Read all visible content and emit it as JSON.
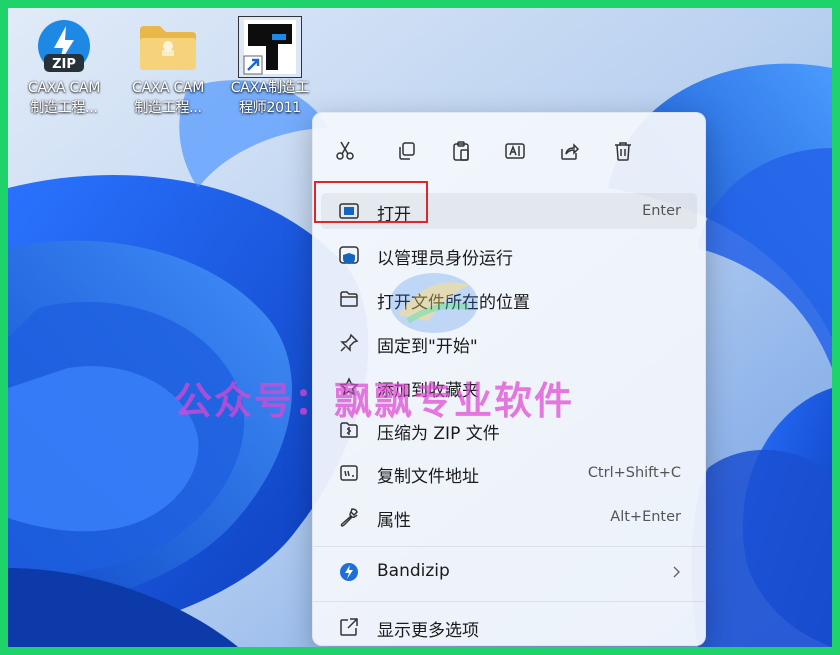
{
  "desktop": {
    "icons": [
      {
        "line1": "CAXA CAM",
        "line2": "制造工程...",
        "badge": "ZIP",
        "icon": "zip-archive-icon"
      },
      {
        "line1": "CAXA CAM",
        "line2": "制造工程...",
        "icon": "folder-icon"
      },
      {
        "line1": "CAXA制造工",
        "line2": "程师2011",
        "icon": "caxa-app-shortcut-icon"
      }
    ]
  },
  "context_menu": {
    "toolbar": [
      {
        "icon": "cut-icon"
      },
      {
        "icon": "copy-icon"
      },
      {
        "icon": "paste-icon"
      },
      {
        "icon": "rename-icon"
      },
      {
        "icon": "share-icon"
      },
      {
        "icon": "delete-icon"
      }
    ],
    "items": [
      {
        "label": "打开",
        "shortcut": "Enter",
        "icon": "open-app-icon"
      },
      {
        "label": "以管理员身份运行",
        "shortcut": "",
        "icon": "shield-run-icon"
      },
      {
        "label": "打开文件所在的位置",
        "shortcut": "",
        "icon": "folder-open-icon"
      },
      {
        "label": "固定到\"开始\"",
        "shortcut": "",
        "icon": "pin-icon"
      },
      {
        "label": "添加到收藏夹",
        "shortcut": "",
        "icon": "star-icon"
      },
      {
        "label": "压缩为 ZIP 文件",
        "shortcut": "",
        "icon": "zip-compress-icon"
      },
      {
        "label": "复制文件地址",
        "shortcut": "Ctrl+Shift+C",
        "icon": "copy-path-icon"
      },
      {
        "label": "属性",
        "shortcut": "Alt+Enter",
        "icon": "wrench-icon"
      },
      {
        "label": "Bandizip",
        "shortcut": "",
        "icon": "bandizip-icon"
      },
      {
        "label": "显示更多选项",
        "shortcut": "",
        "icon": "more-options-icon"
      }
    ]
  },
  "watermark": {
    "text": "公众号：飘飘专业软件"
  },
  "colors": {
    "frame": "#1fd36b",
    "highlight": "#e0262a",
    "accent": "#1565c0"
  }
}
